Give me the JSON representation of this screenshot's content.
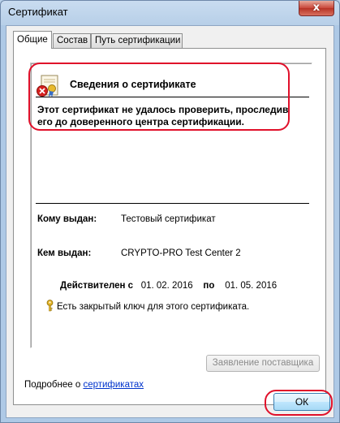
{
  "window": {
    "title": "Сертификат",
    "close_label": "x"
  },
  "tabs": [
    {
      "label": "Общие",
      "active": true
    },
    {
      "label": "Состав",
      "active": false
    },
    {
      "label": "Путь сертификации",
      "active": false
    }
  ],
  "cert": {
    "heading": "Сведения о сертификате",
    "warning": "Этот сертификат не удалось проверить, проследив его до доверенного центра сертификации.",
    "issued_to_label": "Кому выдан:",
    "issued_to_value": "Тестовый сертификат",
    "issued_by_label": "Кем выдан:",
    "issued_by_value": "CRYPTO-PRO Test Center 2",
    "valid_from_label": "Действителен с",
    "valid_from": "01. 02. 2016",
    "valid_to_label": "по",
    "valid_to": "01. 05. 2016",
    "private_key_note": "Есть закрытый ключ для этого сертификата."
  },
  "buttons": {
    "issuer_statement": "Заявление поставщика",
    "ok": "ОК"
  },
  "footer": {
    "more_prefix": "Подробнее о ",
    "more_link": "сертификатах"
  },
  "colors": {
    "annotation": "#e0102a",
    "link": "#0033cc",
    "window_frame": "#aec9e6"
  },
  "icons": [
    "certificate-error-icon",
    "key-icon",
    "close-icon"
  ]
}
